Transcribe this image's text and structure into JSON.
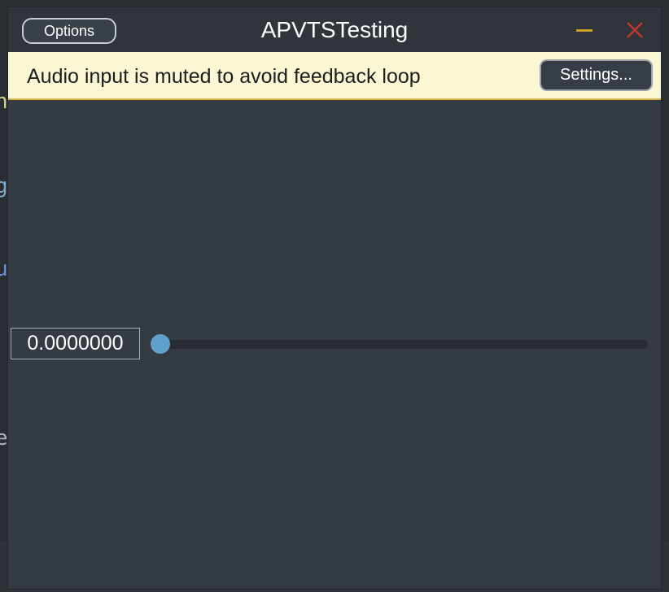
{
  "window": {
    "title": "APVTSTesting",
    "options_label": "Options",
    "minimize_icon": "minimize-icon",
    "close_icon": "close-icon",
    "accent_minimize": "#c9a227",
    "accent_close": "#c0392b"
  },
  "notice": {
    "message": "Audio input is muted to avoid feedback loop",
    "settings_label": "Settings..."
  },
  "slider": {
    "value_text": "0.0000000",
    "value_fraction": 0.0,
    "thumb_color": "#5fa1cc"
  },
  "background": {
    "glyphs": [
      "n",
      "g",
      "u",
      "e"
    ]
  }
}
